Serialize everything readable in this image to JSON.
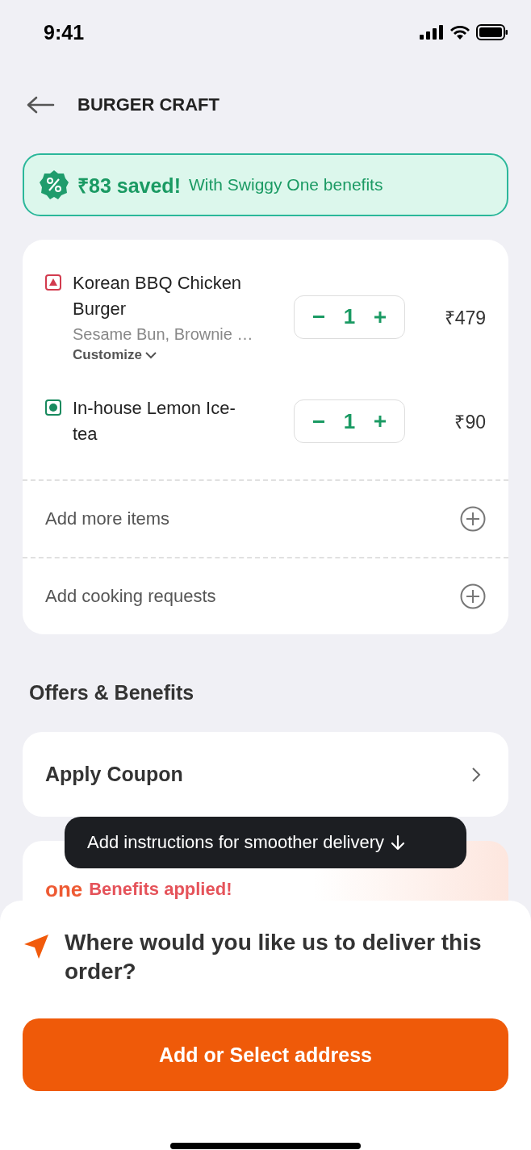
{
  "status_bar": {
    "time": "9:41"
  },
  "header": {
    "title": "BURGER CRAFT"
  },
  "savings_banner": {
    "amount": "₹83 saved!",
    "text": "With Swiggy One benefits"
  },
  "cart_items": [
    {
      "kind": "nonveg",
      "name": "Korean BBQ Chicken Burger",
      "details": "Sesame Bun, Brownie …",
      "customize": "Customize",
      "quantity": "1",
      "price": "₹479"
    },
    {
      "kind": "veg",
      "name": "In-house Lemon Ice-tea",
      "quantity": "1",
      "price": "₹90"
    }
  ],
  "cart_actions": [
    {
      "label": "Add more items"
    },
    {
      "label": "Add cooking requests"
    }
  ],
  "offers": {
    "heading": "Offers & Benefits",
    "coupon": "Apply Coupon",
    "benefits_logo": "one",
    "benefits_text": "Benefits applied!"
  },
  "tooltip": {
    "text": "Add instructions for smoother delivery"
  },
  "delivery": {
    "question": "Where would you like us to deliver this order?",
    "button": "Add or Select address"
  }
}
